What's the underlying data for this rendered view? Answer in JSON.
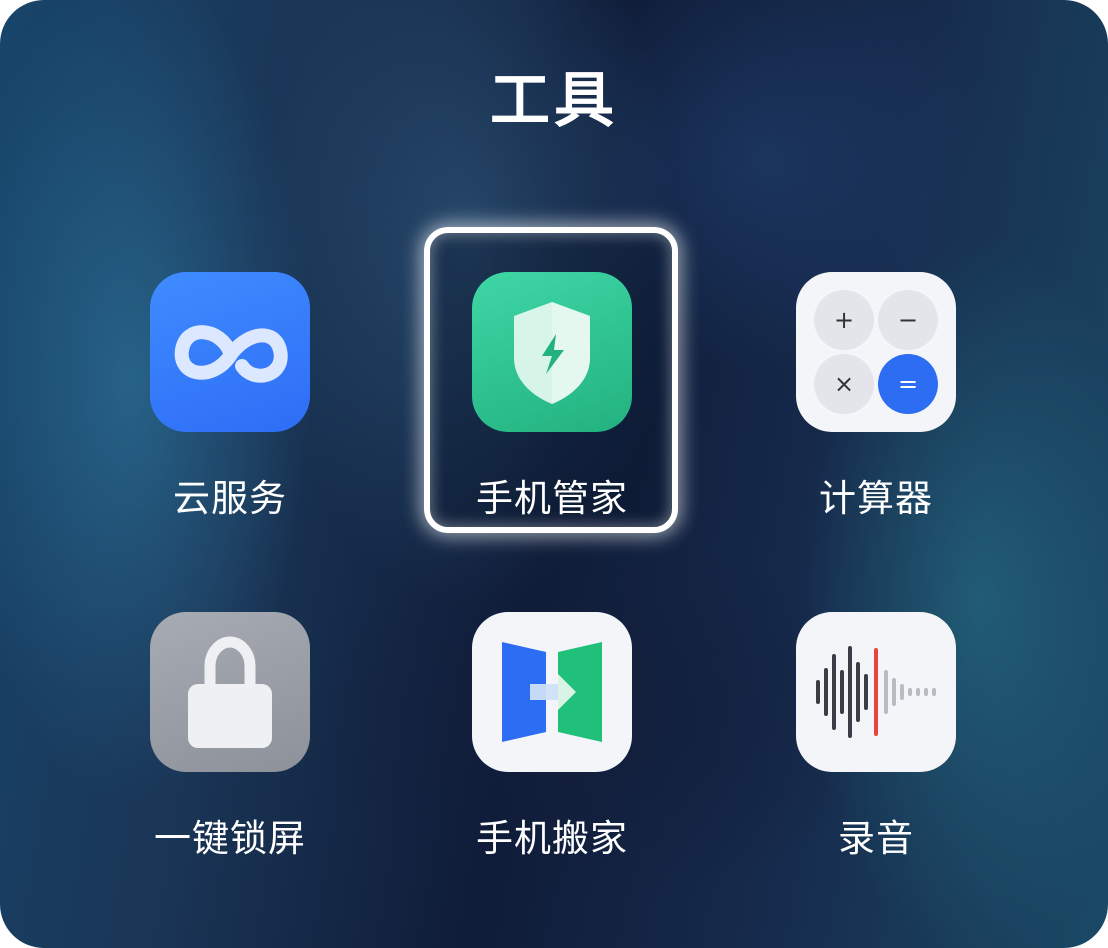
{
  "folder": {
    "title": "工具"
  },
  "apps": [
    {
      "label": "云服务",
      "icon": "cloud-infinity-icon"
    },
    {
      "label": "手机管家",
      "icon": "shield-bolt-icon",
      "focused": true
    },
    {
      "label": "计算器",
      "icon": "calculator-icon"
    },
    {
      "label": "一键锁屏",
      "icon": "padlock-icon"
    },
    {
      "label": "手机搬家",
      "icon": "phone-transfer-icon"
    },
    {
      "label": "录音",
      "icon": "sound-wave-icon"
    }
  ],
  "calculator_keys": [
    "+",
    "−",
    "×",
    "="
  ],
  "colors": {
    "cloud": "#2e6df6",
    "manager": "#22b27f",
    "calc_equals": "#2c6df4",
    "recorder_marker": "#e8453c"
  }
}
